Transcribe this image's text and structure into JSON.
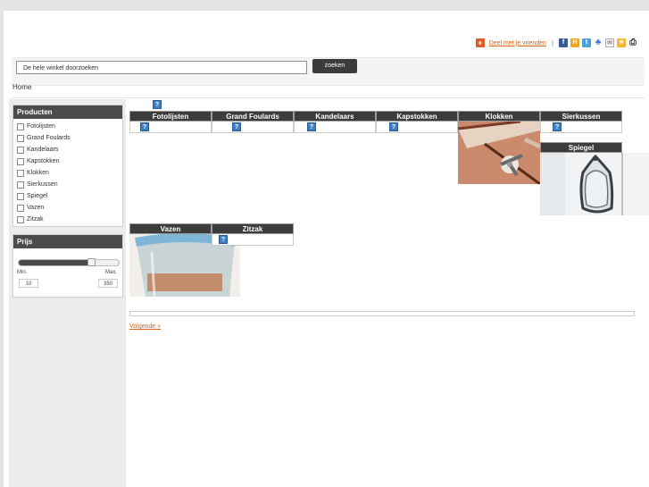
{
  "share": {
    "label": "Deel met je vrienden",
    "separator": "|",
    "icons": [
      "facebook-icon",
      "hyves-icon",
      "twitter-icon",
      "msn-icon",
      "email-icon",
      "favorite-icon",
      "print-icon"
    ]
  },
  "search": {
    "value": "De hele winkel doorzoeken",
    "button_label": "zoeken"
  },
  "breadcrumb": {
    "home": "Home"
  },
  "sidebar": {
    "products_title": "Producten",
    "categories": [
      "Fotolijsten",
      "Grand Foulards",
      "Kandelaars",
      "Kapstokken",
      "Klokken",
      "Sierkussen",
      "Spiegel",
      "Vazen",
      "Zitzak"
    ],
    "price_title": "Prijs",
    "price": {
      "min_label": "Min.",
      "max_label": "Max.",
      "min_value": "10",
      "max_value": "350",
      "range_fill_fraction": 0.72
    }
  },
  "tiles": {
    "fotolijsten": "Fotolijsten",
    "grand_foulards": "Grand Foulards",
    "kandelaars": "Kandelaars",
    "kapstokken": "Kapstokken",
    "klokken": "Klokken",
    "sierkussen": "Sierkussen",
    "spiegel": "Spiegel",
    "vazen": "Vazen",
    "zitzak": "Zitzak"
  },
  "missing_image_glyph": "?",
  "pagination": {
    "next_label": "Volgende »"
  },
  "colors": {
    "header_dark": "#3c3c3c",
    "link_orange": "#e06010",
    "missing_icon_blue": "#3d7fc4"
  }
}
